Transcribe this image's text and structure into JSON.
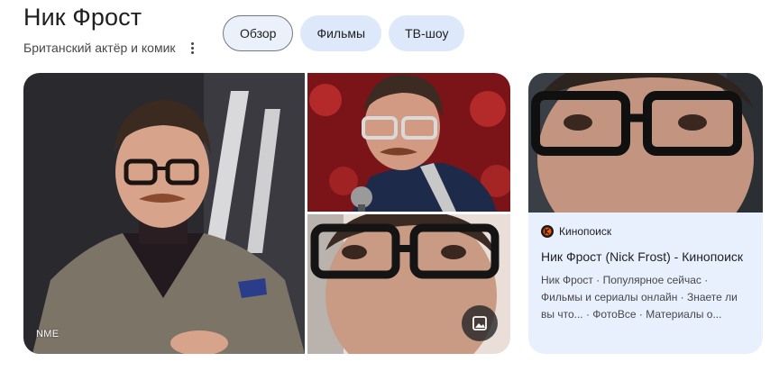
{
  "header": {
    "title": "Ник Фрост",
    "subtitle": "Британский актёр и комик",
    "more_icon": "more-vert-icon"
  },
  "tabs": [
    {
      "label": "Обзор",
      "active": true
    },
    {
      "label": "Фильмы",
      "active": false
    },
    {
      "label": "ТВ-шоу",
      "active": false
    }
  ],
  "images": {
    "main_source": "NME",
    "gallery_icon": "image-gallery-icon"
  },
  "card": {
    "source_name": "Кинопоиск",
    "source_icon": "kinopoisk-favicon",
    "title": "Ник Фрост (Nick Frost) - Кинопоиск",
    "snippet": "Ник Фрост · Популярное сейчас · Фильмы и сериалы онлайн · Знаете ли вы что... · ФотоВсе · Материалы о..."
  },
  "colors": {
    "chip_bg": "#dde9fb",
    "card_bg": "#e8f0fe",
    "kinopoisk_orange": "#ff5500"
  }
}
